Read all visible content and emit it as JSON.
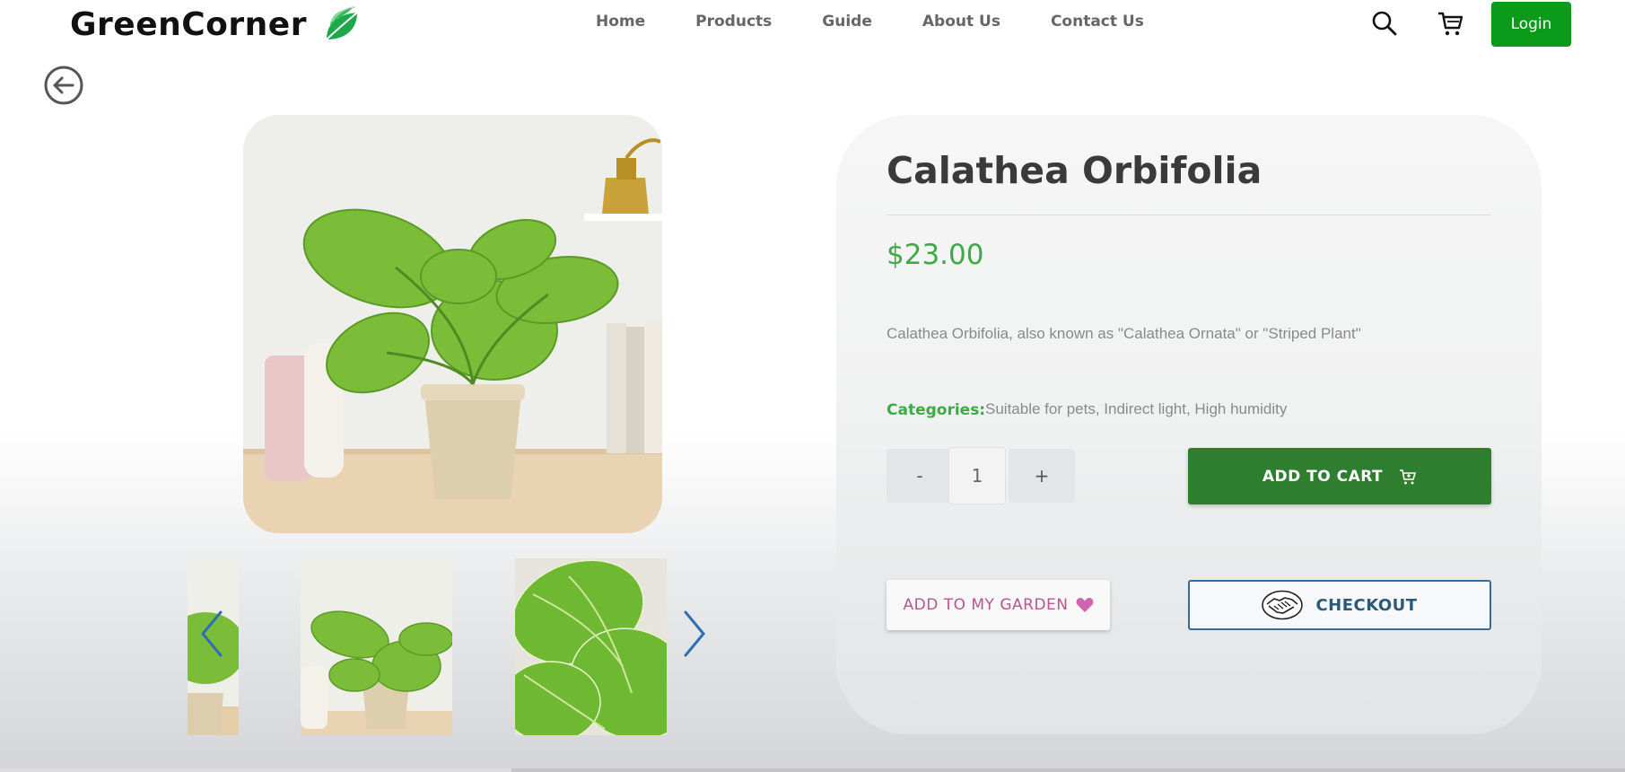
{
  "header": {
    "brand": "GreenCorner",
    "nav": [
      "Home",
      "Products",
      "Guide",
      "About Us",
      "Contact Us"
    ],
    "login_label": "Login",
    "icons": {
      "search": "search-icon",
      "cart": "cart-icon",
      "back": "back-arrow-icon"
    }
  },
  "gallery": {
    "main_image": "Calathea Orbifolia plant in beige ceramic pot on shelf",
    "thumbnails": [
      "plant close-up (partial)",
      "plant in pot",
      "striped leaf close-up"
    ],
    "icons": {
      "prev": "chevron-left-icon",
      "next": "chevron-right-icon"
    }
  },
  "product": {
    "title": "Calathea Orbifolia",
    "price": "$23.00",
    "description": "Calathea Orbifolia, also known as \"Calathea Ornata\" or \"Striped Plant\"",
    "categories_label": "Categories:",
    "categories": "Suitable for pets, Indirect light, High humidity",
    "quantity": "1",
    "minus_label": "-",
    "plus_label": "+",
    "add_to_cart_label": "ADD TO CART",
    "add_to_garden_label": "ADD TO MY GARDEN",
    "checkout_label": "CHECKOUT"
  },
  "colors": {
    "brand_green": "#0c9a1b",
    "price_green": "#3cab47",
    "cart_green": "#2f7d2f",
    "garden_pink": "#b3578e",
    "checkout_blue": "#2f6e9a"
  }
}
